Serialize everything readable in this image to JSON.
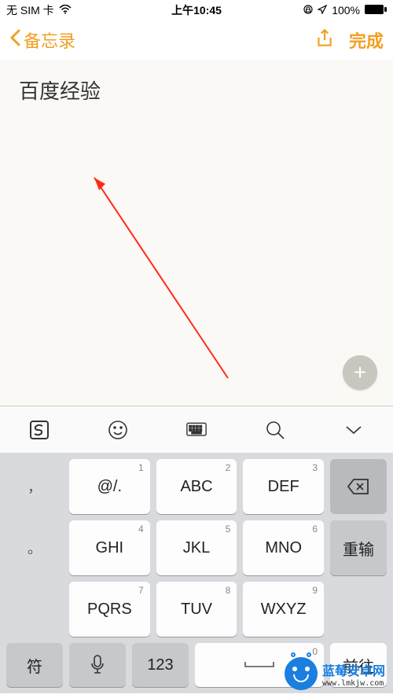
{
  "status": {
    "carrier": "无 SIM 卡",
    "time": "上午10:45",
    "battery": "100%"
  },
  "nav": {
    "back_label": "备忘录",
    "done_label": "完成"
  },
  "note": {
    "content": "百度经验"
  },
  "keyboard": {
    "keys": {
      "r1": [
        {
          "num": "1",
          "label": "@/."
        },
        {
          "num": "2",
          "label": "ABC"
        },
        {
          "num": "3",
          "label": "DEF"
        }
      ],
      "r2": [
        {
          "num": "4",
          "label": "GHI"
        },
        {
          "num": "5",
          "label": "JKL"
        },
        {
          "num": "6",
          "label": "MNO"
        }
      ],
      "r3": [
        {
          "num": "7",
          "label": "PQRS"
        },
        {
          "num": "8",
          "label": "TUV"
        },
        {
          "num": "9",
          "label": "WXYZ"
        }
      ],
      "bottom": {
        "num": "0"
      }
    },
    "side": {
      "comma": "，",
      "period": "。",
      "reinput": "重输",
      "symbol": "符",
      "num": "123",
      "go": "前往"
    }
  },
  "watermark": {
    "title": "蓝莓安卓网",
    "url": "www.lmkjw.com"
  }
}
